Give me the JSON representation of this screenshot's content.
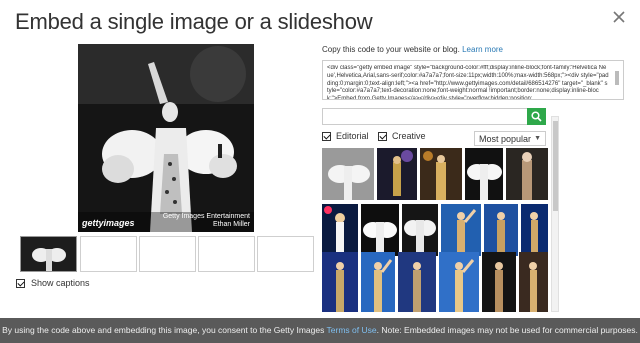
{
  "modal": {
    "title": "Embed a single image or a slideshow",
    "close_icon": "close-icon"
  },
  "main_image": {
    "watermark_logo": "gettyimages",
    "credit_line1": "Getty Images Entertainment",
    "credit_line2": "Ethan Miller"
  },
  "slideshow_thumbs": [
    {
      "state": "selected"
    },
    {
      "state": "empty"
    },
    {
      "state": "empty"
    },
    {
      "state": "empty"
    },
    {
      "state": "empty"
    }
  ],
  "show_captions": {
    "label": "Show captions",
    "checked": true
  },
  "embed": {
    "copy_label": "Copy this code to your website or blog.",
    "learn_more": "Learn more",
    "code": "<div class=\"getty embed image\" style=\"background-color:#fff;display:inline-block;font-family:'Helvetica Neue',Helvetica,Arial,sans-serif;color:#a7a7a7;font-size:11px;width:100%;max-width:568px;\"><div style=\"padding:0;margin:0;text-align:left;\"><a href=\"http://www.gettyimages.com/detail/686514276\" target=\"_blank\" style=\"color:#a7a7a7;text-decoration:none;font-weight:normal !important;border:none;display:inline-block;\">Embed from Getty Images</a></div><div style=\"overflow:hidden;position:"
  },
  "search": {
    "value": "",
    "placeholder": ""
  },
  "filters": {
    "editorial_label": "Editorial",
    "editorial_checked": true,
    "creative_label": "Creative",
    "creative_checked": true,
    "sort_selected": "Most popular"
  },
  "footer": {
    "text_before": "By using the code above and embedding this image, you consent to the Getty Images ",
    "link": "Terms of Use",
    "text_after": ". Note: Embedded images may not be used for commercial purposes."
  },
  "colors": {
    "accent_green": "#2ea84a",
    "link_blue": "#2a7ab5",
    "footer_bg": "#5a5a5a"
  }
}
